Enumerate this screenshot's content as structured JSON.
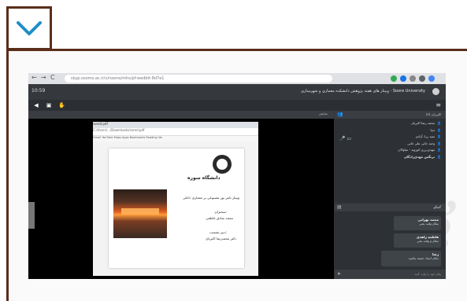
{
  "toggle": {
    "icon": "chevron-down-icon",
    "border_color": "#5a2e1a",
    "icon_color": "#1e8ec7"
  },
  "browser": {
    "nav": [
      "←",
      "→",
      "C"
    ],
    "url": "skyp.sooms.ac.ir/v/rooms/mhs/pf-wedbit-8d7e1",
    "extension_colors": [
      "#34a853",
      "#1a73e8",
      "#888888",
      "#5f6368",
      "#4285f4"
    ]
  },
  "meeting": {
    "clock": "10:59",
    "title": "وبینار های هفته پژوهش دانشکده معماری و شهرسازی - Soore University",
    "users_header": "کاربران (۷)",
    "users": [
      "محمد رضا اکبریان",
      "تدیا",
      "سید رزا، آزادی",
      "وحید جانی علی خانی",
      "مهدی‌برزی کوزوند - ساوالان",
      "ترنگس مهدی‌زادگان"
    ],
    "chat_header": "گفتگو",
    "chat": [
      {
        "name": "محمد تهرانی",
        "text": "سلام وقت بخیر"
      },
      {
        "name": "فاطمه زاهدی",
        "text": "سلام و وقت بخیر"
      },
      {
        "name": "رضا",
        "text": "سلام استاد خسته نباشید"
      }
    ],
    "chat_placeholder": "پیام خود را وارد کنید"
  },
  "ppt": {
    "tab": "sored.pdf",
    "address": "C:/Users/.../Downloads/sored.pdf",
    "bookmarks": "Gmail  YouTube  Maps  Apps  Bookmarks  Reading list",
    "university": "دانشگاه سوره",
    "line1": "وبینار تاثیر نور مصنوعی بر معماری داخلی",
    "speaker_label": "سخنران:",
    "speaker": "محمد صادق عاطفی",
    "host_label": "دبیر نشست:",
    "host": "دکتر محمدرضا اکبریان"
  },
  "share_label": "نمایش"
}
